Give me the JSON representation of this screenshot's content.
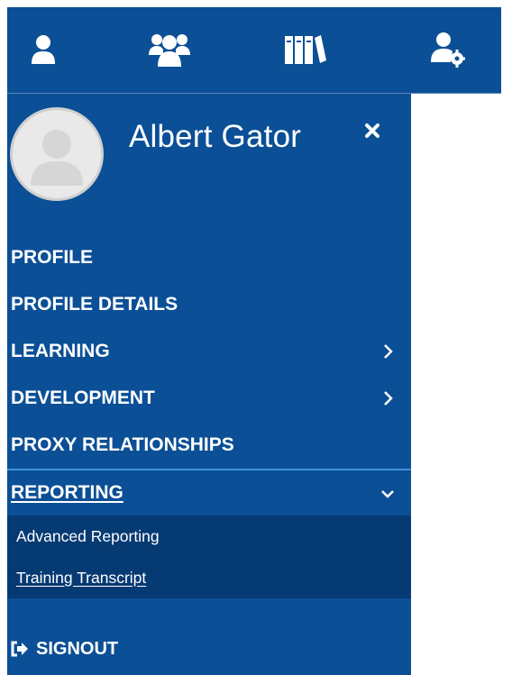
{
  "topbar": {
    "icons": [
      {
        "name": "user-icon"
      },
      {
        "name": "users-group-icon"
      },
      {
        "name": "library-icon"
      },
      {
        "name": "user-settings-icon"
      }
    ]
  },
  "user": {
    "name": "Albert Gator",
    "avatar_icon": "avatar-placeholder-icon",
    "close_icon": "close-icon"
  },
  "menu": {
    "items": [
      {
        "label": "PROFILE"
      },
      {
        "label": "PROFILE DETAILS"
      },
      {
        "label": "LEARNING",
        "chevron": "chevron-right-icon"
      },
      {
        "label": "DEVELOPMENT",
        "chevron": "chevron-right-icon"
      },
      {
        "label": "PROXY RELATIONSHIPS"
      },
      {
        "label": "REPORTING",
        "chevron": "chevron-down-icon",
        "expanded": true
      }
    ],
    "reporting_sub": [
      {
        "label": "Advanced Reporting"
      },
      {
        "label": "Training Transcript",
        "current": true
      }
    ],
    "signout": {
      "label": "SIGNOUT",
      "icon": "sign-out-icon"
    }
  },
  "colors": {
    "primary": "#0b4f96",
    "submenu_bg": "#053a73",
    "active_border": "#3e93dd",
    "text": "#ffffff"
  }
}
